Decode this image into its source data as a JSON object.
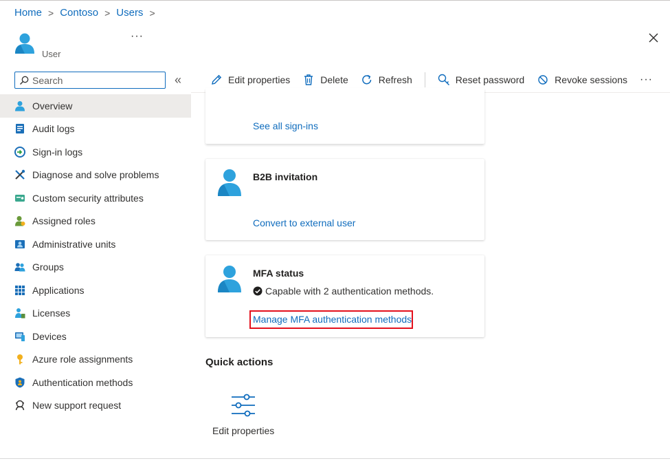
{
  "breadcrumb": [
    {
      "label": "Home"
    },
    {
      "label": "Contoso"
    },
    {
      "label": "Users"
    }
  ],
  "header": {
    "subtitle": "User",
    "more_label": "···"
  },
  "search": {
    "placeholder": "Search",
    "value": "",
    "collapse_label": "«"
  },
  "sidebar": {
    "items": [
      {
        "label": "Overview",
        "icon": "user-icon",
        "active": true
      },
      {
        "label": "Audit logs",
        "icon": "audit-log-icon"
      },
      {
        "label": "Sign-in logs",
        "icon": "sign-in-icon"
      },
      {
        "label": "Diagnose and solve problems",
        "icon": "wrench-icon"
      },
      {
        "label": "Custom security attributes",
        "icon": "security-attributes-icon"
      },
      {
        "label": "Assigned roles",
        "icon": "assigned-roles-icon"
      },
      {
        "label": "Administrative units",
        "icon": "admin-units-icon"
      },
      {
        "label": "Groups",
        "icon": "groups-icon"
      },
      {
        "label": "Applications",
        "icon": "applications-grid-icon"
      },
      {
        "label": "Licenses",
        "icon": "licenses-icon"
      },
      {
        "label": "Devices",
        "icon": "devices-icon"
      },
      {
        "label": "Azure role assignments",
        "icon": "key-icon"
      },
      {
        "label": "Authentication methods",
        "icon": "shield-icon"
      },
      {
        "label": "New support request",
        "icon": "support-icon"
      }
    ]
  },
  "toolbar": {
    "edit_properties": "Edit properties",
    "delete": "Delete",
    "refresh": "Refresh",
    "reset_password": "Reset password",
    "revoke_sessions": "Revoke sessions",
    "more": "···"
  },
  "cards": {
    "signins": {
      "link": "See all sign-ins"
    },
    "b2b": {
      "title": "B2B invitation",
      "link": "Convert to external user"
    },
    "mfa": {
      "title": "MFA status",
      "status": "Capable with 2 authentication methods.",
      "link": "Manage MFA authentication methods"
    }
  },
  "quick_actions": {
    "title": "Quick actions",
    "items": [
      {
        "label": "Edit properties",
        "icon": "sliders-icon"
      }
    ]
  },
  "colors": {
    "accent": "#0f6cbd",
    "highlight": "#e3101c",
    "avatar_blue": "#2ea2dd",
    "active_bg": "#edebe9"
  }
}
